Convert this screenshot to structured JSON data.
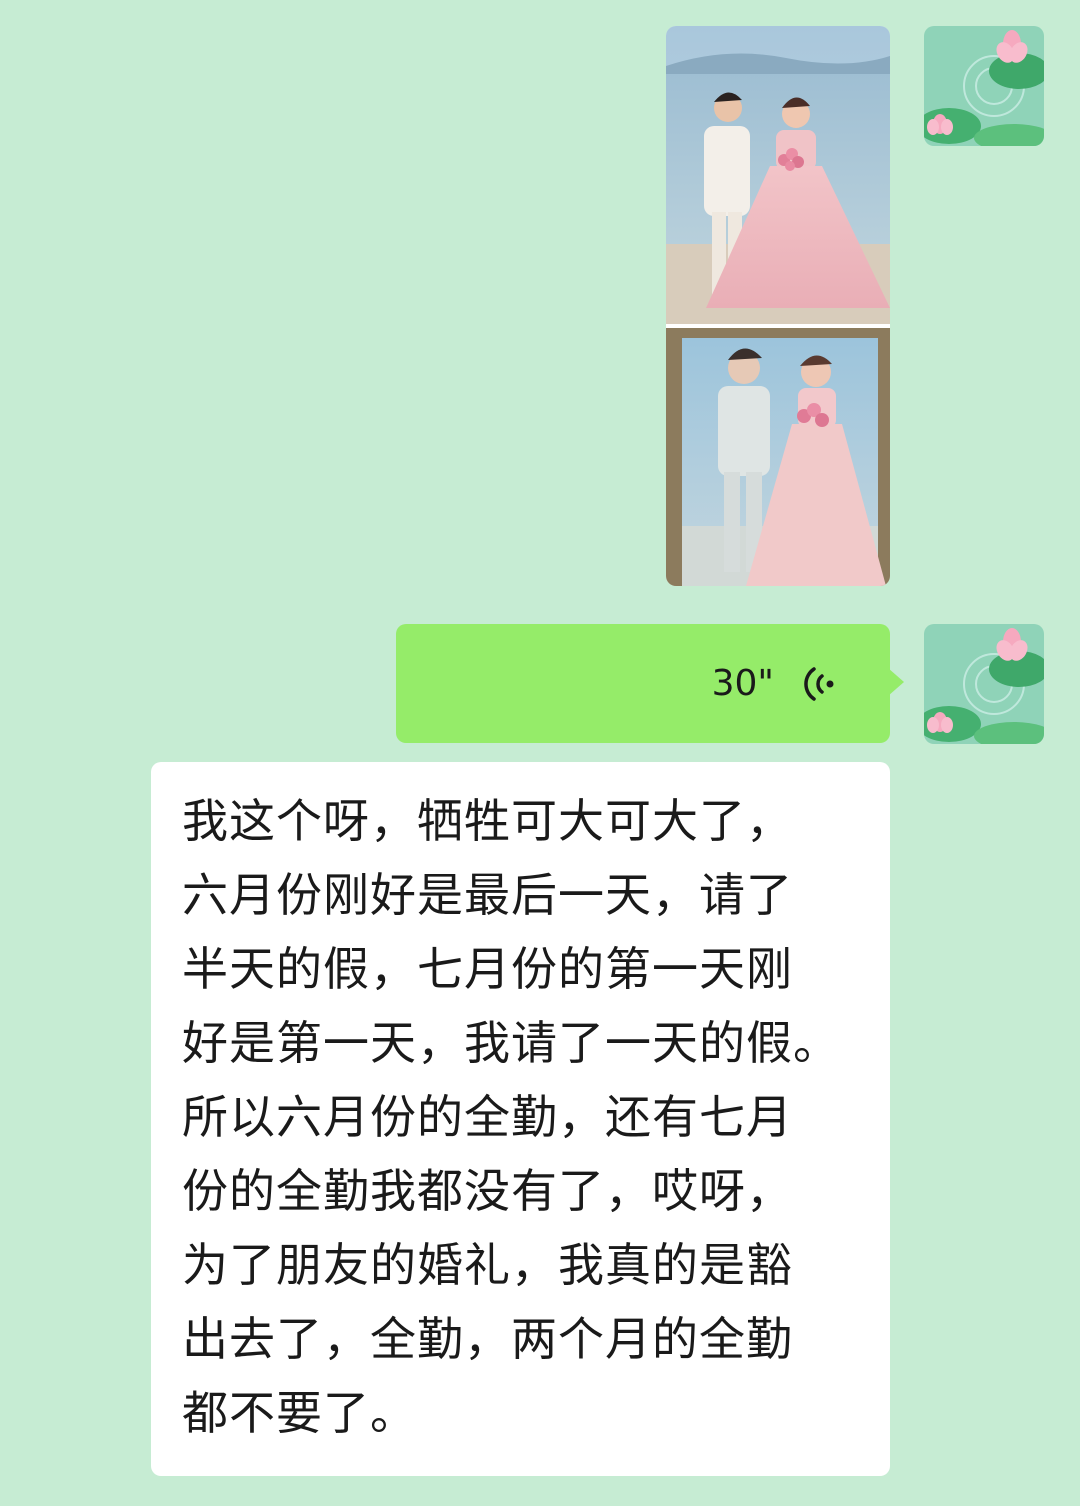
{
  "chat": {
    "messages": [
      {
        "type": "image",
        "sender": "self",
        "images": [
          "wedding-photo-beach",
          "wedding-painting"
        ]
      },
      {
        "type": "voice",
        "sender": "self",
        "duration": "30\""
      },
      {
        "type": "voice-to-text",
        "lines": [
          "我这个呀，牺牲可大可大了，",
          "六月份刚好是最后一天，请了",
          "半天的假，七月份的第一天刚",
          "好是第一天，我请了一天的假。",
          "所以六月份的全勤，还有七月",
          "份的全勤我都没有了，哎呀，",
          "为了朋友的婚礼，我真的是豁",
          "出去了，全勤，两个月的全勤",
          "都不要了。"
        ]
      }
    ]
  },
  "colors": {
    "background": "#c6ecd3",
    "voice_bubble": "#95ec69",
    "text_bubble": "#ffffff",
    "text": "#1a1a1a"
  },
  "icons": {
    "avatar": "lotus-pond-avatar",
    "voice": "voice-wave-icon"
  }
}
